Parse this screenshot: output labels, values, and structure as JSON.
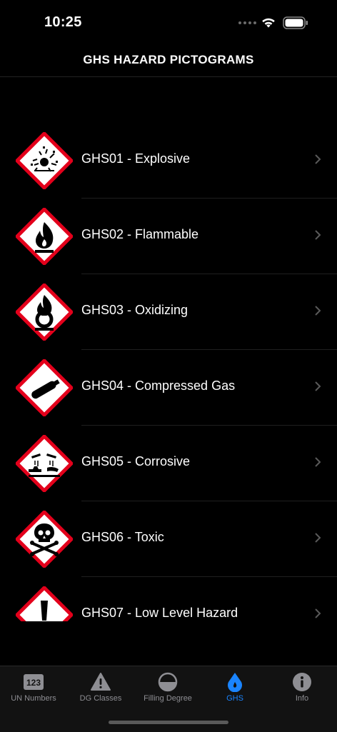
{
  "status_bar": {
    "time": "10:25"
  },
  "header": {
    "title": "GHS HAZARD PICTOGRAMS"
  },
  "list": {
    "items": [
      {
        "label": "GHS01 - Explosive",
        "icon": "explosive-icon"
      },
      {
        "label": "GHS02 - Flammable",
        "icon": "flame-icon"
      },
      {
        "label": "GHS03 - Oxidizing",
        "icon": "flame-over-circle-icon"
      },
      {
        "label": "GHS04 - Compressed Gas",
        "icon": "gas-cylinder-icon"
      },
      {
        "label": "GHS05 - Corrosive",
        "icon": "corrosion-icon"
      },
      {
        "label": "GHS06 - Toxic",
        "icon": "skull-crossbones-icon"
      },
      {
        "label": "GHS07 - Low Level Hazard",
        "icon": "exclamation-mark-icon"
      }
    ]
  },
  "tabbar": {
    "tabs": [
      {
        "label": "UN Numbers",
        "icon": "un-number-icon",
        "active": false
      },
      {
        "label": "DG Classes",
        "icon": "warning-triangle-icon",
        "active": false
      },
      {
        "label": "Filling Degree",
        "icon": "half-circle-icon",
        "active": false
      },
      {
        "label": "GHS",
        "icon": "drop-icon",
        "active": true
      },
      {
        "label": "Info",
        "icon": "info-icon",
        "active": false
      }
    ]
  },
  "colors": {
    "background": "#000000",
    "pictogram_border": "#e3001b",
    "accent": "#1a84ff",
    "tab_inactive": "#8e8e93"
  }
}
